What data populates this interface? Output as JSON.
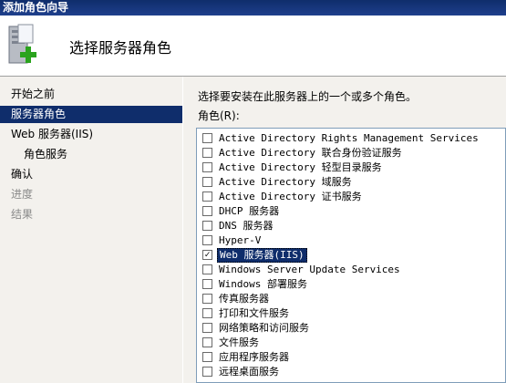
{
  "window": {
    "title": "添加角色向导"
  },
  "header": {
    "title": "选择服务器角色",
    "icon": "server-add-icon"
  },
  "sidebar": {
    "items": [
      {
        "label": "开始之前",
        "state": "normal"
      },
      {
        "label": "服务器角色",
        "state": "active"
      },
      {
        "label": "Web 服务器(IIS)",
        "state": "normal"
      },
      {
        "label": "角色服务",
        "state": "normal"
      },
      {
        "label": "确认",
        "state": "normal"
      },
      {
        "label": "进度",
        "state": "disabled"
      },
      {
        "label": "结果",
        "state": "disabled"
      }
    ]
  },
  "main": {
    "instruction": "选择要安装在此服务器上的一个或多个角色。",
    "roles_label": "角色(R):",
    "roles": [
      {
        "label": "Active Directory Rights Management Services",
        "checked": false
      },
      {
        "label": "Active Directory 联合身份验证服务",
        "checked": false
      },
      {
        "label": "Active Directory 轻型目录服务",
        "checked": false
      },
      {
        "label": "Active Directory 域服务",
        "checked": false
      },
      {
        "label": "Active Directory 证书服务",
        "checked": false
      },
      {
        "label": "DHCP 服务器",
        "checked": false
      },
      {
        "label": "DNS 服务器",
        "checked": false
      },
      {
        "label": "Hyper-V",
        "checked": false
      },
      {
        "label": "Web 服务器(IIS)",
        "checked": true,
        "selected": true
      },
      {
        "label": "Windows Server Update Services",
        "checked": false
      },
      {
        "label": "Windows 部署服务",
        "checked": false
      },
      {
        "label": "传真服务器",
        "checked": false
      },
      {
        "label": "打印和文件服务",
        "checked": false
      },
      {
        "label": "网络策略和访问服务",
        "checked": false
      },
      {
        "label": "文件服务",
        "checked": false
      },
      {
        "label": "应用程序服务器",
        "checked": false
      },
      {
        "label": "远程桌面服务",
        "checked": false
      }
    ]
  }
}
